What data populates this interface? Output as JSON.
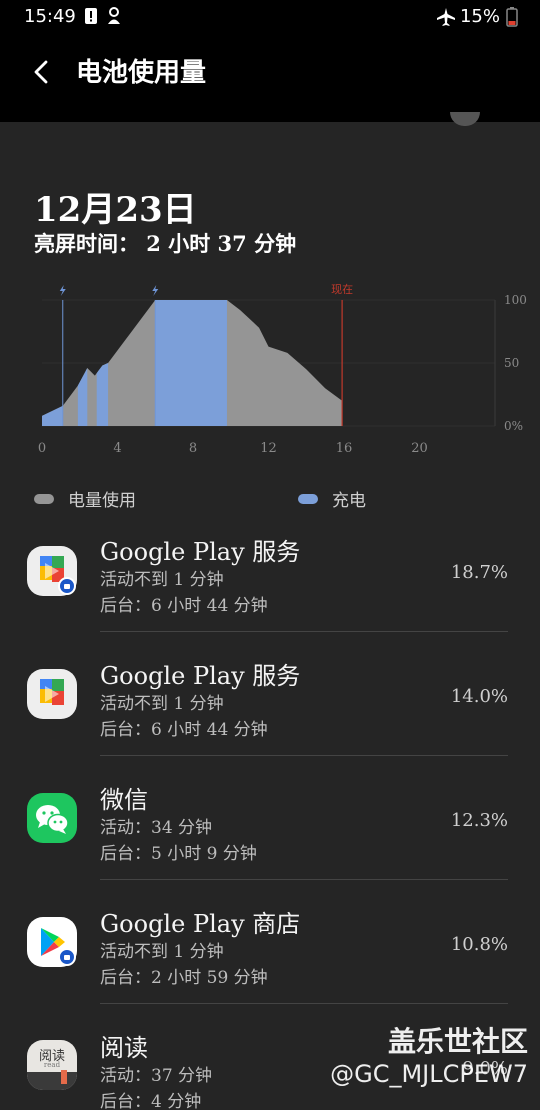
{
  "status_bar": {
    "time": "15:49",
    "battery_percent": "15%"
  },
  "header": {
    "title": "电池使用量"
  },
  "summary": {
    "date": "12月23日",
    "screen_time": "亮屏时间： 2 小时 37 分钟"
  },
  "chart_data": {
    "type": "area",
    "x_ticks": [
      "0",
      "4",
      "8",
      "12",
      "16",
      "20"
    ],
    "y_ticks": [
      "100",
      "50",
      "0%"
    ],
    "now_label": "现在",
    "xlim": [
      0,
      24
    ],
    "ylim": [
      0,
      100
    ],
    "series": [
      {
        "name": "电量使用",
        "x": [
          0,
          1.1,
          1.9,
          2.4,
          2.8,
          3.2,
          3.5,
          6.0,
          9.8,
          10.5,
          11.5,
          12.0,
          13.0,
          14.0,
          15.0,
          15.9
        ],
        "y": [
          8,
          16,
          32,
          46,
          40,
          48,
          50,
          100,
          100,
          92,
          78,
          63,
          58,
          45,
          30,
          20
        ]
      }
    ],
    "charging_intervals": [
      [
        0,
        1.1
      ],
      [
        1.9,
        2.4
      ],
      [
        2.9,
        3.5
      ],
      [
        6.0,
        9.8
      ]
    ],
    "charge_markers": [
      1.1,
      6.0
    ],
    "now_x": 15.9,
    "colors": {
      "usage": "#959595",
      "charging": "#7c9fd9",
      "now": "#c0392b",
      "marker": "#6f95d6"
    }
  },
  "legend": {
    "usage_label": "电量使用",
    "charging_label": "充电",
    "usage_color": "#959595",
    "charging_color": "#7c9fd9"
  },
  "apps": [
    {
      "name": "Google Play 服务",
      "line1": "活动不到 1 分钟",
      "line2": "后台：6 小时 44 分钟",
      "percent": "18.7%",
      "icon": "google-play-services-icon"
    },
    {
      "name": "Google Play 服务",
      "line1": "活动不到 1 分钟",
      "line2": "后台：6 小时 44 分钟",
      "percent": "14.0%",
      "icon": "google-play-services-icon"
    },
    {
      "name": "微信",
      "line1": "活动：34 分钟",
      "line2": "后台：5 小时 9 分钟",
      "percent": "12.3%",
      "icon": "wechat-icon"
    },
    {
      "name": "Google Play 商店",
      "line1": "活动不到 1 分钟",
      "line2": "后台：2 小时 59 分钟",
      "percent": "10.8%",
      "icon": "google-play-store-icon"
    },
    {
      "name": "阅读",
      "line1": "活动：37 分钟",
      "line2": "后台：4 分钟",
      "percent": "9.0%",
      "icon": "read-app-icon",
      "icon_text": "阅读",
      "icon_subtext": "read"
    }
  ],
  "watermark": {
    "title": "盖乐世社区",
    "user": "@GC_MJLCPEW7"
  }
}
